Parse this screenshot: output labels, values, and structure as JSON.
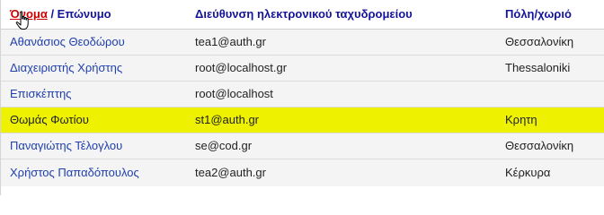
{
  "table": {
    "headers": {
      "name_sort_link": "Όνομα",
      "name_separator": " / Επώνυμο",
      "email": "Διεύθυνση ηλεκτρονικού ταχυδρομείου",
      "city": "Πόλη/χωριό"
    },
    "rows": [
      {
        "name": "Αθανάσιος Θεοδώρου",
        "email": "tea1@auth.gr",
        "city": "Θεσσαλονίκη"
      },
      {
        "name": "Διαχειριστής Χρήστης",
        "email": "root@localhost.gr",
        "city": "Thessaloniki"
      },
      {
        "name": "Επισκέπτης",
        "email": "root@localhost",
        "city": ""
      },
      {
        "name": "Θωμάς Φωτίου",
        "email": "st1@auth.gr",
        "city": "Κρητη"
      },
      {
        "name": "Παναγιώτης Τέλογλου",
        "email": "se@cod.gr",
        "city": "Θεσσαλονίκη"
      },
      {
        "name": "Χρήστος Παπαδόπουλος",
        "email": "tea2@auth.gr",
        "city": "Κέρκυρα"
      }
    ]
  },
  "colors": {
    "highlight_row": "#eef200",
    "header_text": "#14149a",
    "sort_link": "#cc0000",
    "name_link": "#1f3fae"
  },
  "icons": {
    "cursor": "hand-pointer-icon"
  }
}
